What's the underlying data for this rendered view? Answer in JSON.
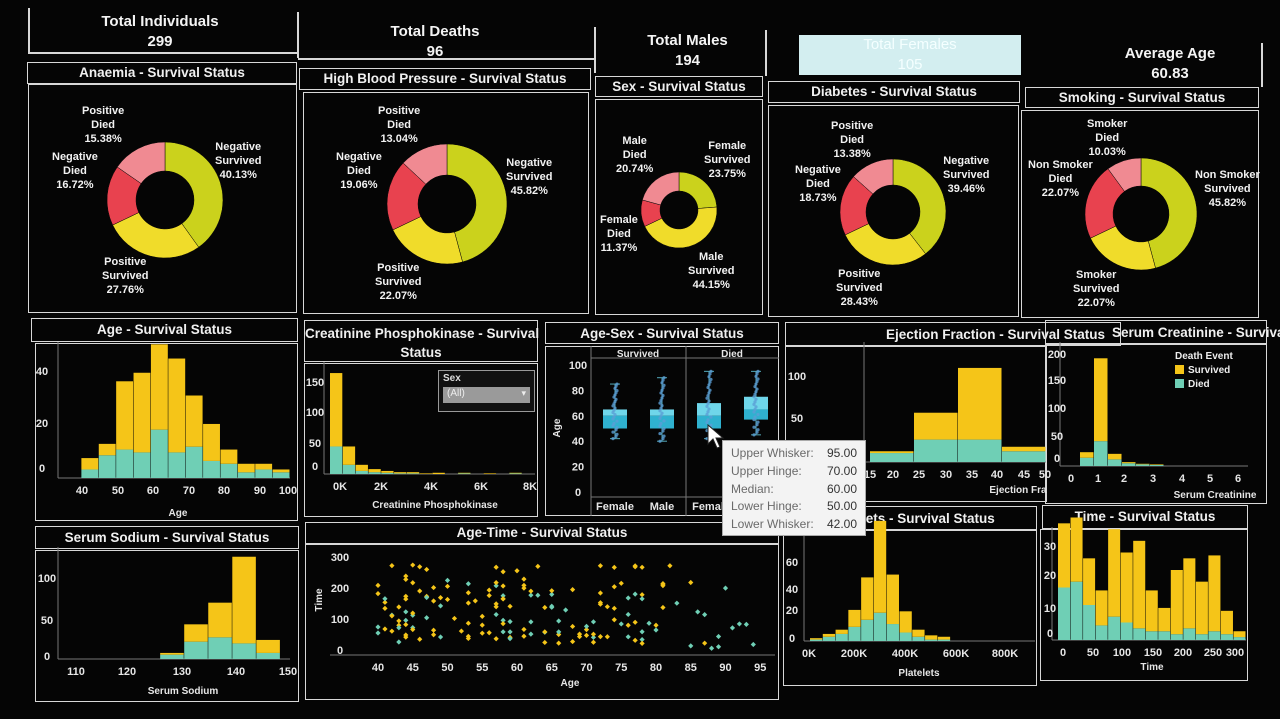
{
  "colors": {
    "survived": "#f5c518",
    "died": "#6fcfb5",
    "positive_died": "#f08a92",
    "negative_died": "#e8424f",
    "negative_survived": "#cbd21c",
    "positive_survived": "#f0dc2a",
    "highlight_kpi": "#d3eef0",
    "box": "#3fc3dd"
  },
  "kpis": {
    "total_individuals": {
      "label": "Total Individuals",
      "value": "299"
    },
    "total_deaths": {
      "label": "Total Deaths",
      "value": "96"
    },
    "total_males": {
      "label": "Total Males",
      "value": "194"
    },
    "total_females": {
      "label": "Total Females",
      "value": "105"
    },
    "average_age": {
      "label": "Average Age",
      "value": "60.83"
    }
  },
  "donuts": {
    "anaemia": {
      "title": "Anaemia - Survival Status",
      "labels": {
        "pos_died": "Positive\nDied\n15.38%",
        "neg_died": "Negative\nDied\n16.72%",
        "neg_surv": "Negative\nSurvived\n40.13%",
        "pos_surv": "Positive\nSurvived\n27.76%"
      },
      "values": [
        40.13,
        27.76,
        16.72,
        15.38
      ]
    },
    "hbp": {
      "title": "High Blood Pressure - Survival Status",
      "labels": {
        "pos_died": "Positive\nDied\n13.04%",
        "neg_died": "Negative\nDied\n19.06%",
        "neg_surv": "Negative\nSurvived\n45.82%",
        "pos_surv": "Positive\nSurvived\n22.07%"
      },
      "values": [
        45.82,
        22.07,
        19.06,
        13.04
      ]
    },
    "sex": {
      "title": "Sex - Survival Status",
      "labels": {
        "pos_died": "Male\nDied\n20.74%",
        "neg_died": "Female\nDied\n11.37%",
        "neg_surv": "Female\nSurvived\n23.75%",
        "pos_surv": "Male\nSurvived\n44.15%"
      },
      "values": [
        23.75,
        44.15,
        11.37,
        20.74
      ]
    },
    "diabetes": {
      "title": "Diabetes - Survival Status",
      "labels": {
        "pos_died": "Positive\nDied\n13.38%",
        "neg_died": "Negative\nDied\n18.73%",
        "neg_surv": "Negative\nSurvived\n39.46%",
        "pos_surv": "Positive\nSurvived\n28.43%"
      },
      "values": [
        39.46,
        28.43,
        18.73,
        13.38
      ]
    },
    "smoking": {
      "title": "Smoking - Survival Status",
      "labels": {
        "pos_died": "Smoker\nDied\n10.03%",
        "neg_died": "Non Smoker\nDied\n22.07%",
        "neg_surv": "Non Smoker\nSurvived\n45.82%",
        "pos_surv": "Smoker\nSurvived\n22.07%"
      },
      "values": [
        45.82,
        22.07,
        22.07,
        10.03
      ]
    }
  },
  "panels": {
    "age": {
      "title": "Age - Survival Status",
      "xlabel": "Age"
    },
    "cpk": {
      "title": "Creatinine Phosphokinase - Survival\nStatus",
      "xlabel": "Creatinine Phosphokinase"
    },
    "agesex": {
      "title": "Age-Sex - Survival Status",
      "ylabel": "Age",
      "survived": "Survived",
      "died": "Died"
    },
    "ef": {
      "title": "Ejection Fraction - Survival Status",
      "xlabel": "Ejection Fra"
    },
    "sc": {
      "title": "Serum Creatinine - Survival",
      "xlabel": "Serum Creatinine"
    },
    "sodium": {
      "title": "Serum Sodium - Survival Status",
      "xlabel": "Serum Sodium"
    },
    "agetime": {
      "title": "Age-Time - Survival Status",
      "xlabel": "Age",
      "ylabel": "Time"
    },
    "platelets": {
      "title": "lets - Survival Status",
      "xlabel": "Platelets"
    },
    "time": {
      "title": "Time - Survival Status",
      "xlabel": "Time"
    }
  },
  "filter": {
    "label": "Sex",
    "value": "(All)"
  },
  "legend": {
    "title": "Death Event",
    "survived": "Survived",
    "died": "Died"
  },
  "tooltip": [
    {
      "k": "Upper Whisker:",
      "v": "95.00"
    },
    {
      "k": "Upper Hinge:",
      "v": "70.00"
    },
    {
      "k": "Median:",
      "v": "60.00"
    },
    {
      "k": "Lower Hinge:",
      "v": "50.00"
    },
    {
      "k": "Lower Whisker:",
      "v": "42.00"
    }
  ],
  "chart_data": [
    {
      "id": "age",
      "type": "bar",
      "title": "Age - Survival Status",
      "xlabel": "Age",
      "ylim": [
        0,
        45
      ],
      "yticks": [
        "0",
        "20",
        "40"
      ],
      "xticks": [
        "40",
        "50",
        "60",
        "70",
        "80",
        "90",
        "100"
      ],
      "x": [
        40,
        45,
        50,
        55,
        60,
        65,
        70,
        75,
        80,
        85,
        90,
        95
      ],
      "series": [
        {
          "name": "Died",
          "values": [
            3,
            8,
            10,
            9,
            17,
            9,
            11,
            6,
            5,
            2,
            3,
            2
          ]
        },
        {
          "name": "Survived",
          "values": [
            4,
            4,
            24,
            28,
            30,
            33,
            18,
            13,
            5,
            3,
            2,
            1
          ]
        }
      ]
    },
    {
      "id": "cpk",
      "type": "bar",
      "title": "Creatinine Phosphokinase - Survival Status",
      "xlabel": "Creatinine Phosphokinase",
      "ylim": [
        0,
        170
      ],
      "yticks": [
        "0",
        "50",
        "100",
        "150"
      ],
      "xticks": [
        "0K",
        "2K",
        "4K",
        "6K",
        "8K"
      ],
      "x": [
        0,
        0.5,
        1,
        1.5,
        2,
        2.5,
        3,
        3.5,
        4,
        5,
        6,
        7
      ],
      "series": [
        {
          "name": "Died",
          "values": [
            45,
            15,
            5,
            3,
            2,
            1,
            1,
            0,
            0,
            1,
            0,
            1
          ]
        },
        {
          "name": "Survived",
          "values": [
            120,
            30,
            10,
            5,
            3,
            2,
            2,
            1,
            2,
            1,
            1,
            1
          ]
        }
      ]
    },
    {
      "id": "agesex",
      "type": "box",
      "ylabel": "Age",
      "yticks": [
        "0",
        "20",
        "40",
        "60",
        "80",
        "100"
      ],
      "xticks": [
        "Female",
        "Male",
        "Female"
      ],
      "groups": [
        {
          "name": "Survived Female",
          "lw": 42,
          "q1": 50,
          "med": 60,
          "q3": 65,
          "uw": 85
        },
        {
          "name": "Survived Male",
          "lw": 40,
          "q1": 50,
          "med": 60,
          "q3": 65,
          "uw": 90
        },
        {
          "name": "Died Female",
          "lw": 42,
          "q1": 50,
          "med": 60,
          "q3": 70,
          "uw": 95
        },
        {
          "name": "Died Male",
          "lw": 45,
          "q1": 57,
          "med": 65,
          "q3": 75,
          "uw": 95
        }
      ]
    },
    {
      "id": "ef",
      "type": "bar",
      "xlabel": "Ejection Fra",
      "ylim": [
        0,
        125
      ],
      "yticks": [
        "50",
        "100"
      ],
      "xticks": [
        "15",
        "20",
        "25",
        "30",
        "35",
        "40",
        "45",
        "50"
      ],
      "x": [
        15,
        25,
        35,
        45
      ],
      "series": [
        {
          "name": "Died",
          "values": [
            10,
            25,
            25,
            12
          ]
        },
        {
          "name": "Survived",
          "values": [
            2,
            30,
            80,
            5
          ]
        }
      ]
    },
    {
      "id": "sc",
      "type": "bar",
      "xlabel": "Serum Creatinine",
      "ylim": [
        0,
        210
      ],
      "yticks": [
        "0",
        "50",
        "100",
        "150",
        "200"
      ],
      "xticks": [
        "0",
        "1",
        "2",
        "3",
        "4",
        "5",
        "6"
      ],
      "x": [
        0.5,
        1,
        1.5,
        2,
        2.5,
        3
      ],
      "series": [
        {
          "name": "Died",
          "values": [
            15,
            45,
            12,
            5,
            3,
            2
          ]
        },
        {
          "name": "Survived",
          "values": [
            10,
            150,
            10,
            2,
            1,
            1
          ]
        }
      ]
    },
    {
      "id": "sodium",
      "type": "bar",
      "xlabel": "Serum Sodium",
      "ylim": [
        0,
        120
      ],
      "yticks": [
        "0",
        "50",
        "100"
      ],
      "xticks": [
        "110",
        "120",
        "130",
        "140",
        "150"
      ],
      "x": [
        125,
        130,
        135,
        140,
        145
      ],
      "series": [
        {
          "name": "Died",
          "values": [
            5,
            20,
            25,
            18,
            7
          ]
        },
        {
          "name": "Survived",
          "values": [
            2,
            20,
            40,
            100,
            15
          ]
        }
      ]
    },
    {
      "id": "platelets",
      "type": "bar",
      "xlabel": "Platelets",
      "ylim": [
        0,
        75
      ],
      "yticks": [
        "0",
        "20",
        "40",
        "60"
      ],
      "xticks": [
        "0K",
        "200K",
        "400K",
        "600K",
        "800K"
      ],
      "x": [
        0,
        50,
        100,
        150,
        200,
        250,
        300,
        350,
        400,
        450,
        500
      ],
      "series": [
        {
          "name": "Died",
          "values": [
            1,
            3,
            5,
            10,
            15,
            20,
            12,
            6,
            3,
            1,
            1
          ]
        },
        {
          "name": "Survived",
          "values": [
            1,
            2,
            3,
            12,
            30,
            65,
            35,
            15,
            5,
            3,
            2
          ]
        }
      ]
    },
    {
      "id": "time",
      "type": "bar",
      "xlabel": "Time",
      "ylim": [
        0,
        36
      ],
      "yticks": [
        "0",
        "10",
        "20",
        "30"
      ],
      "xticks": [
        "0",
        "50",
        "100",
        "150",
        "200",
        "250",
        "300"
      ],
      "x": [
        0,
        20,
        40,
        60,
        80,
        100,
        120,
        140,
        160,
        180,
        200,
        220,
        240,
        260,
        280
      ],
      "series": [
        {
          "name": "Died",
          "values": [
            18,
            20,
            12,
            5,
            8,
            6,
            4,
            3,
            3,
            2,
            4,
            2,
            3,
            2,
            1
          ]
        },
        {
          "name": "Survived",
          "values": [
            22,
            22,
            16,
            12,
            30,
            24,
            30,
            14,
            8,
            22,
            24,
            18,
            26,
            8,
            2
          ]
        }
      ]
    }
  ]
}
